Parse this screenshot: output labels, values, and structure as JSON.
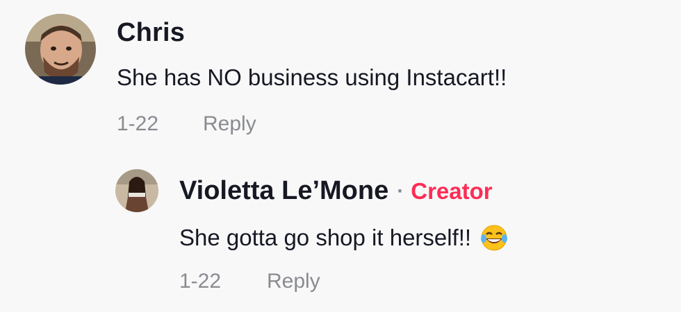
{
  "comment": {
    "author": "Chris",
    "text": "She has NO business using Instacart!!",
    "date": "1-22",
    "reply_label": "Reply"
  },
  "reply": {
    "author": "Violetta Le’Mone",
    "separator": "·",
    "badge": "Creator",
    "badge_color": "#fe2c55",
    "text": "She gotta go shop it herself!!",
    "emoji_icon": "laughing-crying-emoji-icon",
    "date": "1-22",
    "reply_label": "Reply"
  }
}
